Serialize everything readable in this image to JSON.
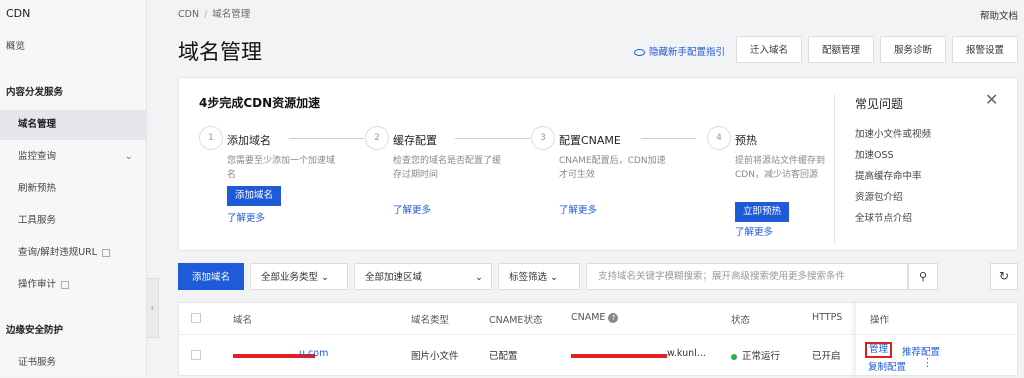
{
  "sidebar": {
    "title": "CDN",
    "items": [
      {
        "label": "概览"
      },
      {
        "label": "内容分发服务"
      },
      {
        "label": "域名管理"
      },
      {
        "label": "监控查询"
      },
      {
        "label": "刷新预热"
      },
      {
        "label": "工具服务"
      },
      {
        "label": "查询/解封违规URL"
      },
      {
        "label": "操作审计"
      },
      {
        "label": "边缘安全防护"
      },
      {
        "label": "证书服务"
      }
    ]
  },
  "header": {
    "breadcrumb": [
      "CDN",
      "域名管理"
    ],
    "help": "帮助文档",
    "title": "域名管理",
    "hide_guide": "隐藏新手配置指引",
    "buttons": [
      "迁入域名",
      "配额管理",
      "服务诊断",
      "报警设置"
    ]
  },
  "guide": {
    "title": "4步完成CDN资源加速",
    "steps": [
      {
        "num": "1",
        "title": "添加域名",
        "desc": "您需要至少添加一个加速域名",
        "button": "添加域名",
        "more": "了解更多"
      },
      {
        "num": "2",
        "title": "缓存配置",
        "desc": "检查您的域名是否配置了缓存过期时间",
        "more": "了解更多"
      },
      {
        "num": "3",
        "title": "配置CNAME",
        "desc": "CNAME配置后，CDN加速才可生效",
        "more": "了解更多"
      },
      {
        "num": "4",
        "title": "预热",
        "desc": "提前将源站文件缓存到CDN，减少访客回源",
        "button": "立即预热",
        "more": "了解更多"
      }
    ],
    "faq": {
      "title": "常见问题",
      "items": [
        "加速小文件或视频",
        "加速OSS",
        "提高缓存命中率",
        "资源包介绍",
        "全球节点介绍"
      ]
    }
  },
  "toolbar": {
    "add_domain": "添加域名",
    "business_type": "全部业务类型",
    "region": "全部加速区域",
    "tag_filter": "标签筛选",
    "search_placeholder": "支持域名关键字模糊搜索；展开高级搜索使用更多搜索条件"
  },
  "table": {
    "headers": [
      "域名",
      "域名类型",
      "CNAME状态",
      "CNAME",
      "状态",
      "HTTPS",
      "操作"
    ],
    "rows": [
      {
        "domain_suffix": "u.com",
        "type": "图片小文件",
        "cname_status": "已配置",
        "cname_suffix": "w.kunl...",
        "status": "正常运行",
        "https": "已开启",
        "actions": [
          "管理",
          "推荐配置",
          "复制配置"
        ]
      }
    ]
  },
  "colors": {
    "accent": "#1f5bd8",
    "success": "#2ab34b",
    "redact": "#e02020"
  }
}
